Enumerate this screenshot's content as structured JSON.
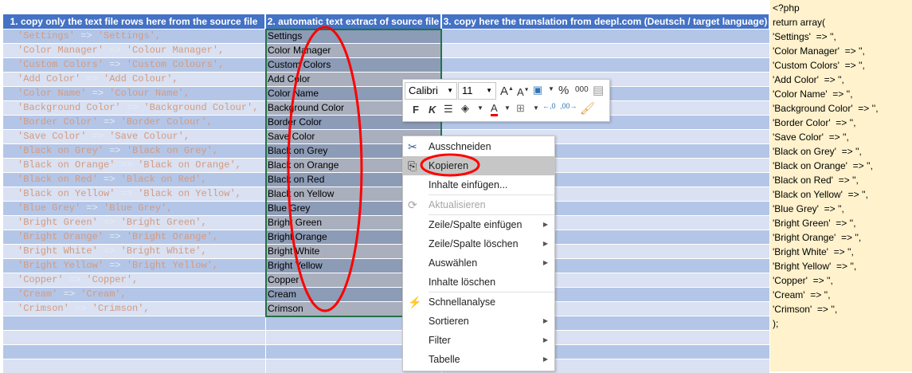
{
  "headers": [
    "1. copy only the text file rows here from the source file",
    "2. automatic text extract of source file",
    "3. copy here the translation from deepl.com (Deutsch / target language)"
  ],
  "rows": [
    {
      "key": "'Settings'",
      "val": "'Settings',",
      "extract": "Settings"
    },
    {
      "key": "'Color Manager'",
      "val": "'Colour Manager',",
      "extract": "Color Manager"
    },
    {
      "key": "'Custom Colors'",
      "val": "'Custom Colours',",
      "extract": "Custom Colors"
    },
    {
      "key": "'Add Color'",
      "val": "'Add Colour',",
      "extract": "Add Color"
    },
    {
      "key": "'Color Name'",
      "val": "'Colour Name',",
      "extract": "Color Name"
    },
    {
      "key": "'Background Color'",
      "val": "'Background Colour',",
      "extract": "Background Color"
    },
    {
      "key": "'Border Color'",
      "val": "'Border Colour',",
      "extract": "Border Color"
    },
    {
      "key": "'Save Color'",
      "val": "'Save Colour',",
      "extract": "Save Color"
    },
    {
      "key": "'Black on Grey'",
      "val": "'Black on Grey',",
      "extract": "Black on Grey"
    },
    {
      "key": "'Black on Orange'",
      "val": "'Black on Orange',",
      "extract": "Black on Orange"
    },
    {
      "key": "'Black on Red'",
      "val": "'Black on Red',",
      "extract": "Black on Red"
    },
    {
      "key": "'Black on Yellow'",
      "val": "'Black on Yellow',",
      "extract": "Black on Yellow"
    },
    {
      "key": "'Blue Grey'",
      "val": "'Blue Grey',",
      "extract": "Blue Grey"
    },
    {
      "key": "'Bright Green'",
      "val": "'Bright Green',",
      "extract": "Bright Green"
    },
    {
      "key": "'Bright Orange'",
      "val": "'Bright Orange',",
      "extract": "Bright Orange"
    },
    {
      "key": "'Bright White'",
      "val": "'Bright White',",
      "extract": "Bright White"
    },
    {
      "key": "'Bright Yellow'",
      "val": "'Bright Yellow',",
      "extract": "Bright Yellow"
    },
    {
      "key": "'Copper'",
      "val": "'Copper',",
      "extract": "Copper"
    },
    {
      "key": "'Cream'",
      "val": "'Cream',",
      "extract": "Cream"
    },
    {
      "key": "'Crimson'",
      "val": "'Crimson',",
      "extract": "Crimson"
    }
  ],
  "arrow": "=>",
  "php_lines": [
    "<?php",
    "return array(",
    "'Settings'  => '',",
    "'Color Manager'  => '',",
    "'Custom Colors'  => '',",
    "'Add Color'  => '',",
    "'Color Name'  => '',",
    "'Background Color'  => '',",
    "'Border Color'  => '',",
    "'Save Color'  => '',",
    "'Black on Grey'  => '',",
    "'Black on Orange'  => '',",
    "'Black on Red'  => '',",
    "'Black on Yellow'  => '',",
    "'Blue Grey'  => '',",
    "'Bright Green'  => '',",
    "'Bright Orange'  => '',",
    "'Bright White'  => '',",
    "'Bright Yellow'  => '',",
    "'Copper'  => '',",
    "'Cream'  => '',",
    "'Crimson'  => '',",
    ");"
  ],
  "mini_toolbar": {
    "font": "Calibri",
    "size": "11",
    "bold": "F",
    "italic": "K",
    "percent": "%",
    "thousands": "000"
  },
  "context_menu": [
    {
      "label": "Ausschneiden",
      "icon": "scissors-icon"
    },
    {
      "label": "Kopieren",
      "icon": "copy-icon",
      "highlighted": true
    },
    {
      "label": "Inhalte einfügen..."
    },
    {
      "label": "Aktualisieren",
      "icon": "refresh-icon",
      "disabled": true
    },
    {
      "label": "Zeile/Spalte einfügen",
      "submenu": true
    },
    {
      "label": "Zeile/Spalte löschen",
      "submenu": true
    },
    {
      "label": "Auswählen",
      "submenu": true
    },
    {
      "label": "Inhalte löschen"
    },
    {
      "label": "Schnellanalyse",
      "icon": "quick-analysis-icon"
    },
    {
      "label": "Sortieren",
      "submenu": true
    },
    {
      "label": "Filter",
      "submenu": true
    },
    {
      "label": "Tabelle",
      "submenu": true
    }
  ],
  "colors": {
    "header": "#4472c4",
    "row_dark": "#b4c6e7",
    "row_light": "#d9e1f2",
    "selection_border": "#217346",
    "annotation": "#ff0000",
    "php_panel": "#fff2cc"
  }
}
